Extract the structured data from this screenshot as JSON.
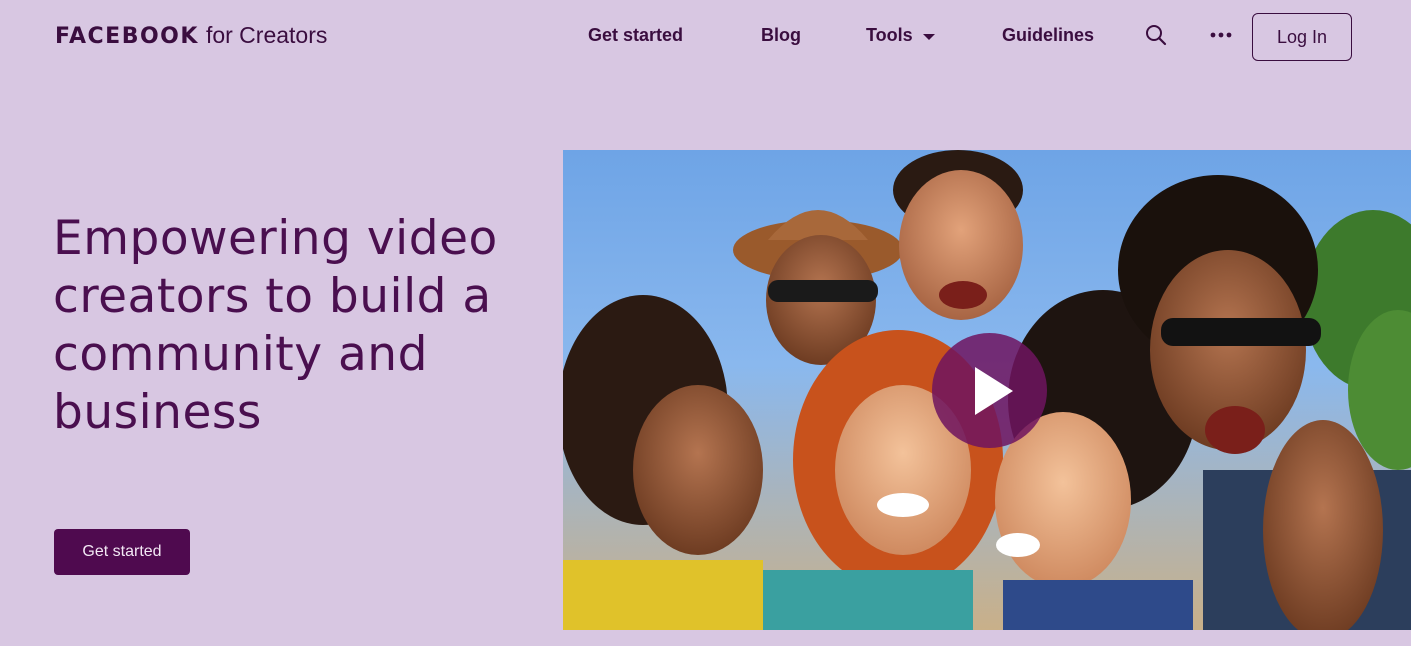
{
  "header": {
    "logo_main": "FACEBOOK",
    "logo_sub": "for Creators",
    "nav": {
      "get_started": "Get started",
      "blog": "Blog",
      "tools": "Tools",
      "guidelines": "Guidelines"
    },
    "icons": {
      "search": "search-icon",
      "more": "more-dots-icon",
      "tools_caret": "caret-down-icon"
    },
    "login_label": "Log In"
  },
  "hero": {
    "heading": "Empowering video creators to build a community and business",
    "cta_label": "Get started"
  },
  "video": {
    "icon": "play-icon",
    "description_colors": {
      "overlay": "#6e145f",
      "sky": "#6ea4e6"
    }
  },
  "colors": {
    "background": "#d8c7e2",
    "primary": "#4a0f4f",
    "button": "#4f0a4f"
  }
}
